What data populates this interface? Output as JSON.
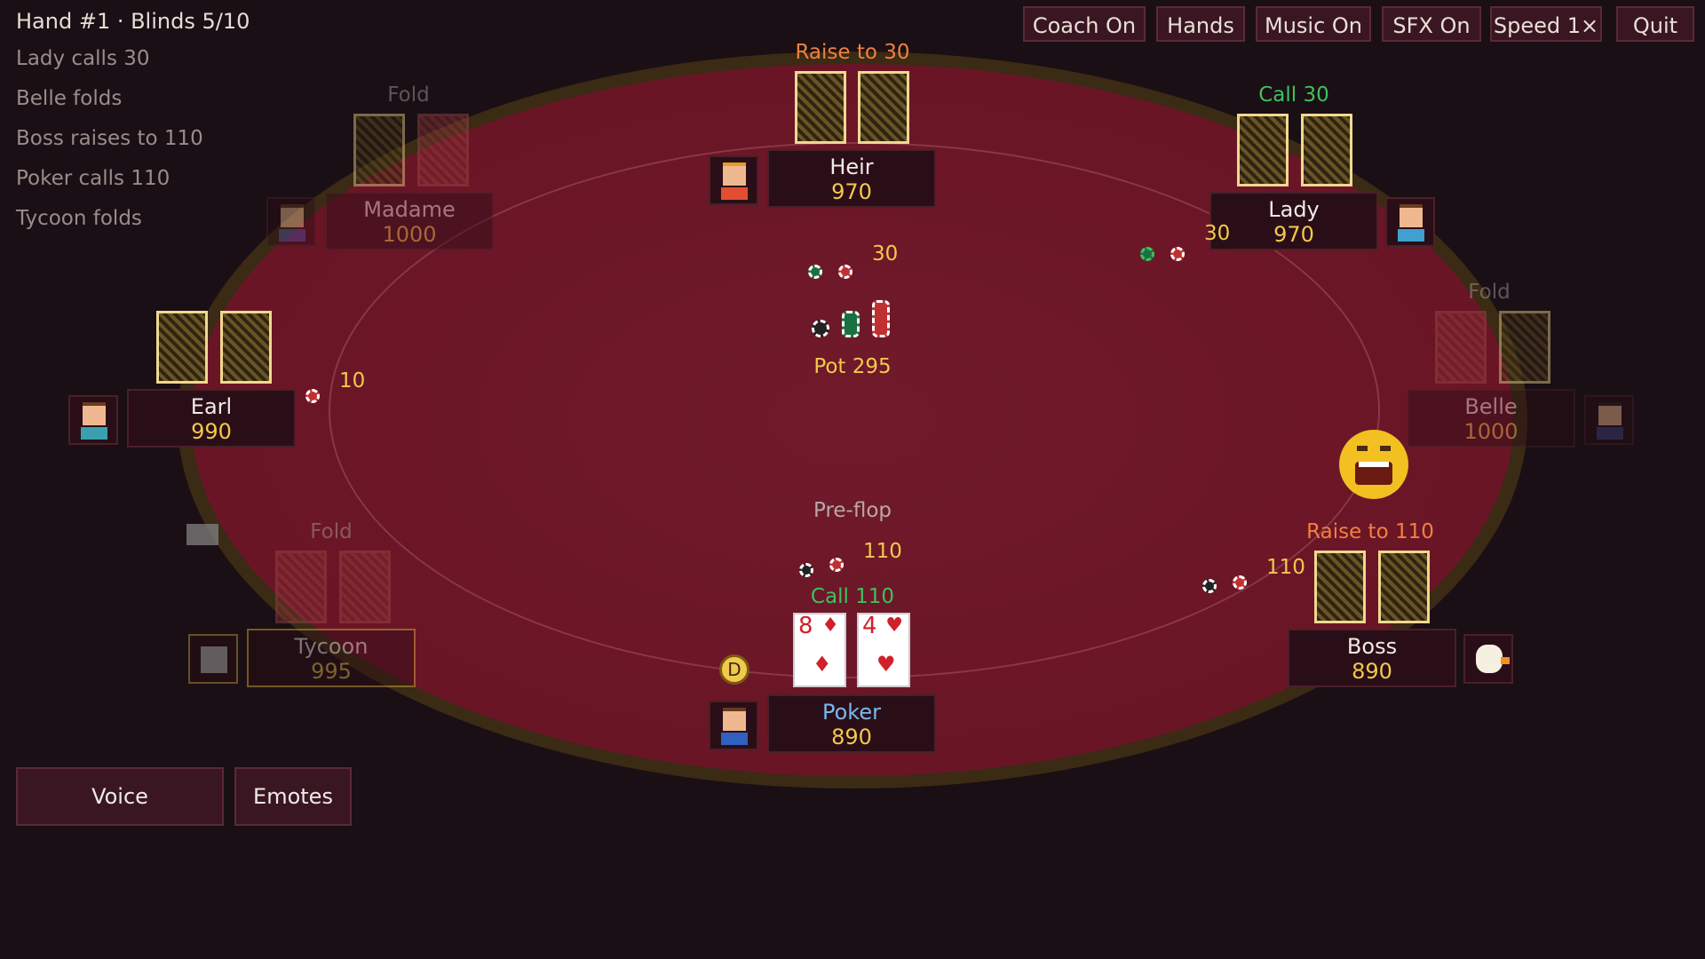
{
  "hand_info": "Hand #1 · Blinds 5/10",
  "log": [
    "Lady calls 30",
    "Belle folds",
    "Boss raises to 110",
    "Poker calls 110",
    "Tycoon folds"
  ],
  "top_buttons": [
    "Coach On",
    "Hands",
    "Music On",
    "SFX On",
    "Speed 1×",
    "Quit"
  ],
  "players": {
    "heir": {
      "name": "Heir",
      "chips": "970",
      "action": "Raise to 30"
    },
    "madame": {
      "name": "Madame",
      "chips": "1000",
      "action": "Fold"
    },
    "lady": {
      "name": "Lady",
      "chips": "970",
      "action": "Call 30",
      "bet": "30"
    },
    "earl": {
      "name": "Earl",
      "chips": "990",
      "bet": "10"
    },
    "belle": {
      "name": "Belle",
      "chips": "1000",
      "action": "Fold"
    },
    "tycoon": {
      "name": "Tycoon",
      "chips": "995",
      "action": "Fold"
    },
    "boss": {
      "name": "Boss",
      "chips": "890",
      "action": "Raise to 110",
      "bet": "110"
    },
    "poker": {
      "name": "Poker",
      "chips": "890",
      "action": "Call 110",
      "bet": "110",
      "cards": [
        {
          "rank": "8",
          "suit": "♦"
        },
        {
          "rank": "4",
          "suit": "♥"
        }
      ]
    }
  },
  "center": {
    "heir_bet": "30",
    "pot": "Pot 295",
    "stage": "Pre-flop"
  },
  "dealer_button": "D",
  "bottom_buttons": {
    "voice": "Voice",
    "emotes": "Emotes"
  },
  "colors": {
    "raise": "#f08040",
    "call": "#3ec060",
    "fold": "#8a7f80",
    "chips": "#f2c94c",
    "hero_name": "#7ab8f0"
  }
}
